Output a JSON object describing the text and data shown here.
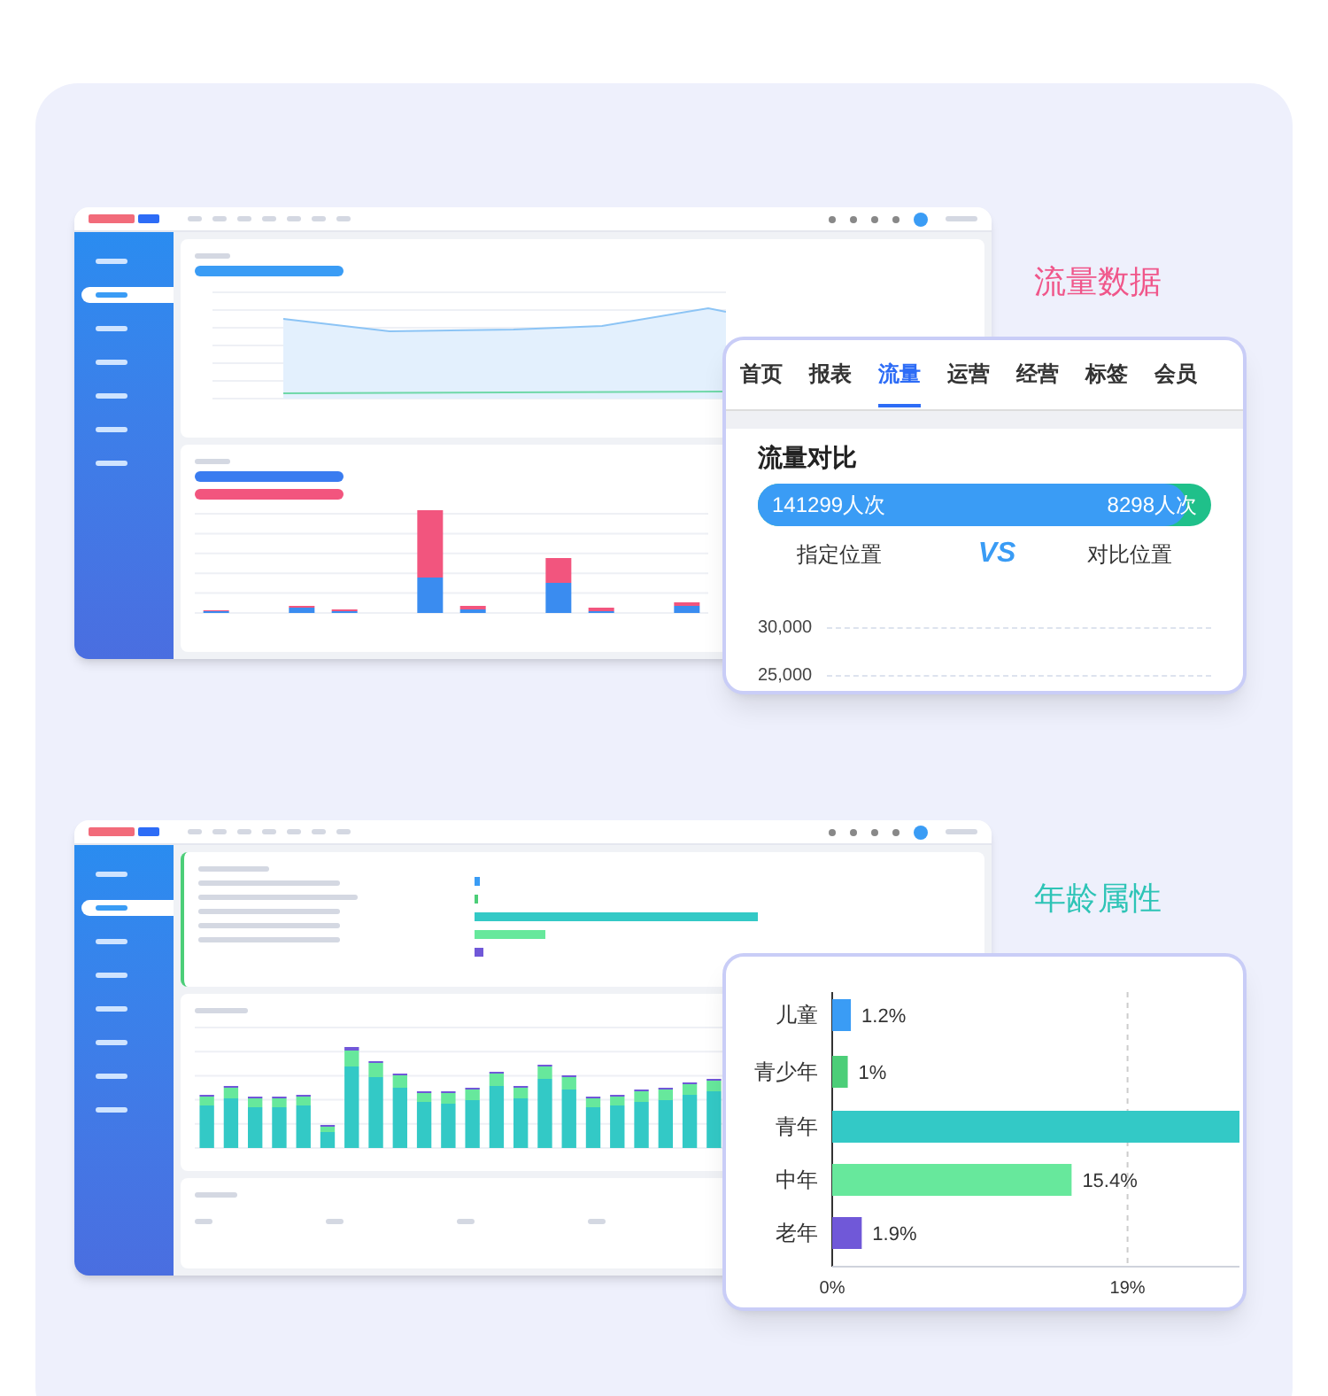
{
  "traffic_panel": {
    "caption": "流量数据",
    "tabs": [
      {
        "label": "首页",
        "selected": false
      },
      {
        "label": "报表",
        "selected": false
      },
      {
        "label": "流量",
        "selected": true
      },
      {
        "label": "运营",
        "selected": false
      },
      {
        "label": "经营",
        "selected": false
      },
      {
        "label": "标签",
        "selected": false
      },
      {
        "label": "会员",
        "selected": false
      }
    ],
    "section_title": "流量对比",
    "compare": {
      "left_value": "141299人次",
      "right_value": "8298人次",
      "level": 0.945,
      "left_label": "指定位置",
      "vs": "VS",
      "right_label": "对比位置"
    },
    "yticks": [
      "30,000",
      "25,000"
    ]
  },
  "age_panel": {
    "caption": "年龄属性",
    "chart_data": {
      "type": "bar",
      "orientation": "horizontal",
      "categories": [
        "儿童",
        "青少年",
        "青年",
        "中年",
        "老年"
      ],
      "values": [
        1.2,
        1,
        26.2,
        15.4,
        1.9
      ],
      "xlim": [
        0,
        26.2
      ],
      "value_labels": [
        "1.2%",
        "1%",
        null,
        "15.4%",
        "1.9%"
      ],
      "xticks": [
        {
          "value": 0,
          "label": "0%"
        },
        {
          "value": 19,
          "label": "19%"
        }
      ]
    }
  }
}
